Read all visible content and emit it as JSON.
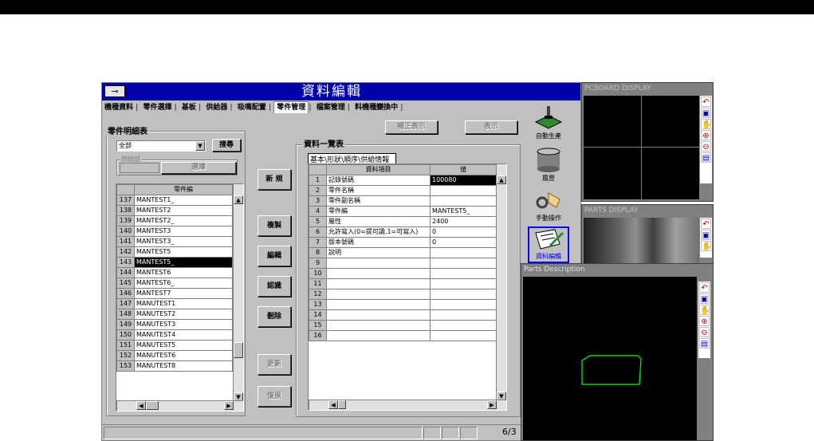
{
  "window": {
    "title": "資料編輯",
    "tabs": [
      {
        "label": "機種資料",
        "selected": false
      },
      {
        "label": "零件選擇",
        "selected": false
      },
      {
        "label": "基板",
        "selected": false
      },
      {
        "label": "供給器",
        "selected": false
      },
      {
        "label": "吸嘴配置",
        "selected": false
      },
      {
        "label": "零件管理",
        "selected": true
      },
      {
        "label": "檔案管理",
        "selected": false
      },
      {
        "label": "料機種變換中",
        "selected": false
      }
    ]
  },
  "parts_list": {
    "heading": "零件明細表",
    "filter_value": "全部",
    "search_label": "搜尋",
    "supplier_label": "供給部",
    "select_label": "選擇",
    "column_header": "零件編",
    "rows": [
      {
        "num": "137",
        "name": "MANTEST1_"
      },
      {
        "num": "138",
        "name": "MANTEST2"
      },
      {
        "num": "139",
        "name": "MANTEST2_"
      },
      {
        "num": "140",
        "name": "MANTEST3"
      },
      {
        "num": "141",
        "name": "MANTEST3_"
      },
      {
        "num": "142",
        "name": "MANTEST5"
      },
      {
        "num": "143",
        "name": "MANTEST5_"
      },
      {
        "num": "144",
        "name": "MANTEST6"
      },
      {
        "num": "145",
        "name": "MANTEST6_"
      },
      {
        "num": "146",
        "name": "MANTEST7"
      },
      {
        "num": "147",
        "name": "MANUTEST1"
      },
      {
        "num": "148",
        "name": "MANUTEST2"
      },
      {
        "num": "149",
        "name": "MANUTEST3"
      },
      {
        "num": "150",
        "name": "MANUTEST4"
      },
      {
        "num": "151",
        "name": "MANUTEST5"
      },
      {
        "num": "152",
        "name": "MANUTEST6"
      },
      {
        "num": "153",
        "name": "MANUTEST8"
      }
    ],
    "selected_index": 6
  },
  "actions": {
    "new": "新 規",
    "copy": "複製",
    "edit": "編輯",
    "recognize": "認識",
    "delete": "刪除",
    "update": "更新",
    "restore": "復原"
  },
  "data_table": {
    "modify_display": "補正表示",
    "display": "表示",
    "heading": "資料一覽表",
    "tabs": [
      "基本",
      "形狀",
      "順序",
      "供給情報"
    ],
    "col_item": "資料項目",
    "col_value": "値",
    "rows": [
      {
        "num": "1",
        "item": "記錄號碼",
        "value": "100080"
      },
      {
        "num": "2",
        "item": "零件名稱",
        "value": ""
      },
      {
        "num": "3",
        "item": "零件副名稱",
        "value": ""
      },
      {
        "num": "4",
        "item": "零件編",
        "value": "MANTEST5_"
      },
      {
        "num": "5",
        "item": "屬性",
        "value": "2400"
      },
      {
        "num": "6",
        "item": "允許寫入(0=提可讀,1=可寫入)",
        "value": "0"
      },
      {
        "num": "7",
        "item": "版本號碼",
        "value": "0"
      },
      {
        "num": "8",
        "item": "說明",
        "value": ""
      },
      {
        "num": "9",
        "item": "",
        "value": ""
      },
      {
        "num": "10",
        "item": "",
        "value": ""
      },
      {
        "num": "11",
        "item": "",
        "value": ""
      },
      {
        "num": "12",
        "item": "",
        "value": ""
      },
      {
        "num": "13",
        "item": "",
        "value": ""
      },
      {
        "num": "14",
        "item": "",
        "value": ""
      },
      {
        "num": "15",
        "item": "",
        "value": ""
      },
      {
        "num": "16",
        "item": "",
        "value": ""
      }
    ]
  },
  "side_modes": {
    "auto": "自動生產",
    "history": "履歷",
    "manual": "手動操作",
    "data_edit": "資料編輯"
  },
  "status": {
    "page": "6/3"
  },
  "panels": {
    "pcboard": "PCBOARD DISPLAY",
    "parts": "PARTS DISPLAY",
    "description": "Parts Description"
  },
  "colors": {
    "title_bar": "#0000aa",
    "display_bg": "#000000",
    "outline": "#00ff00"
  }
}
